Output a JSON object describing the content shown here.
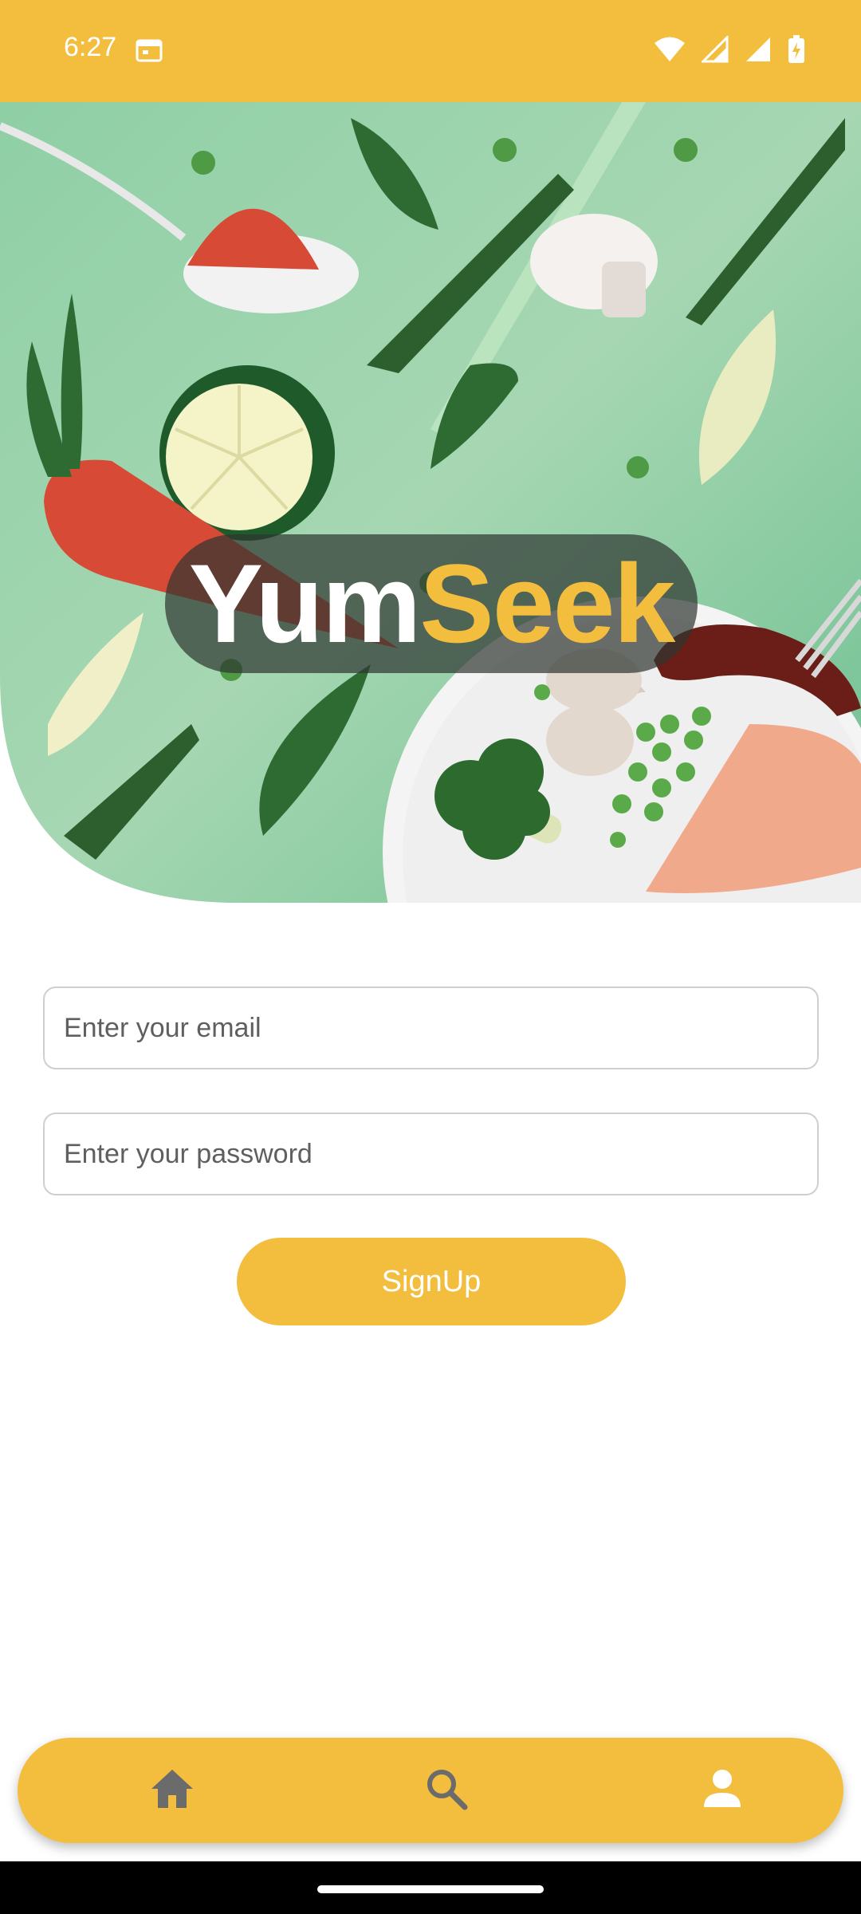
{
  "status_bar": {
    "time": "6:27",
    "icons": [
      "calendar-icon",
      "wifi-icon",
      "signal-icon",
      "signal-icon",
      "battery-charging-icon"
    ]
  },
  "hero": {
    "logo_part1": "Yum",
    "logo_part2": "Seek"
  },
  "form": {
    "email_placeholder": "Enter your email",
    "password_placeholder": "Enter your password",
    "signup_label": "SignUp"
  },
  "bottom_nav": {
    "items": [
      {
        "icon": "home-icon"
      },
      {
        "icon": "search-icon"
      },
      {
        "icon": "person-icon"
      }
    ]
  },
  "colors": {
    "brand_yellow": "#F3BD3E",
    "hero_green": "#8FCFA6",
    "icon_grey": "#6b6b6b"
  }
}
